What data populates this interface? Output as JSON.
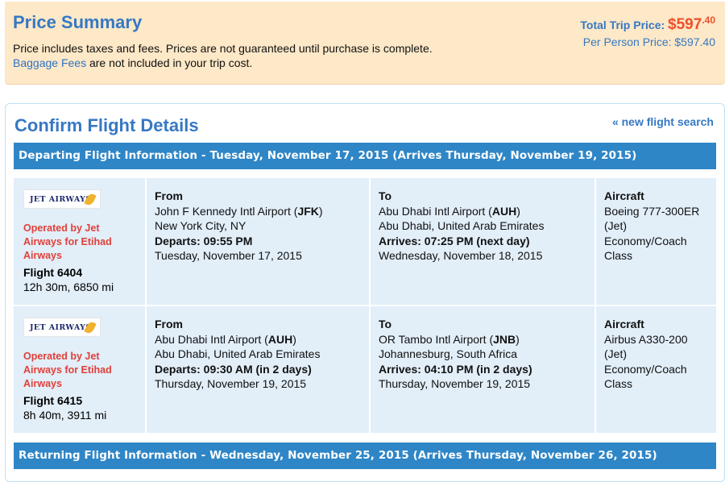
{
  "summary": {
    "title": "Price Summary",
    "line1": "Price includes taxes and fees. Prices are not guaranteed until purchase is complete.",
    "baggage_link": "Baggage Fees",
    "line2_rest": " are not included in your trip cost.",
    "total_label": "Total Trip Price: ",
    "total_amount": "$597",
    "total_cents": ".40",
    "per_person": "Per Person Price: $597.40"
  },
  "confirm": {
    "title": "Confirm Flight Details",
    "new_search": "« new flight search"
  },
  "departing_header": "Departing Flight Information - Tuesday, November 17, 2015 (Arrives Thursday, November 19, 2015)",
  "returning_header": "Returning Flight Information - Wednesday, November 25, 2015 (Arrives Thursday, November 26, 2015)",
  "flights": [
    {
      "logo": "JET AIRWAYS",
      "operated": "Operated by Jet Airways for Etihad Airways",
      "flight": "Flight 6404",
      "duration": "12h 30m, 6850 mi",
      "from_label": "From",
      "from_airport_name": "John F Kennedy Intl Airport (",
      "from_code": "JFK",
      "from_city": "New York City, NY",
      "depart_label": "Departs: 09:55 PM",
      "depart_date": "Tuesday, November 17, 2015",
      "to_label": "To",
      "to_airport_name": "Abu Dhabi Intl Airport (",
      "to_code": "AUH",
      "to_city": "Abu Dhabi, United Arab Emirates",
      "arrive_label": "Arrives: 07:25 PM (next day)",
      "arrive_date": "Wednesday, November 18, 2015",
      "aircraft_label": "Aircraft",
      "aircraft": "Boeing 777-300ER (Jet)",
      "cabin": "Economy/Coach Class"
    },
    {
      "logo": "JET AIRWAYS",
      "operated": "Operated by Jet Airways for Etihad Airways",
      "flight": "Flight 6415",
      "duration": "8h 40m, 3911 mi",
      "from_label": "From",
      "from_airport_name": "Abu Dhabi Intl Airport (",
      "from_code": "AUH",
      "from_city": "Abu Dhabi, United Arab Emirates",
      "depart_label": "Departs: 09:30 AM (in 2 days)",
      "depart_date": "Thursday, November 19, 2015",
      "to_label": "To",
      "to_airport_name": "OR Tambo Intl Airport (",
      "to_code": "JNB",
      "to_city": "Johannesburg, South Africa",
      "arrive_label": "Arrives: 04:10 PM (in 2 days)",
      "arrive_date": "Thursday, November 19, 2015",
      "aircraft_label": "Aircraft",
      "aircraft": "Airbus A330-200 (Jet)",
      "cabin": "Economy/Coach Class"
    }
  ],
  "colors": {
    "accent_blue": "#3678c4",
    "bar_blue": "#2e86c7",
    "price_orange": "#f04f2a",
    "operated_red": "#e0403a",
    "summary_bg": "#fde8c7",
    "row_bg": "#e2eef8"
  }
}
